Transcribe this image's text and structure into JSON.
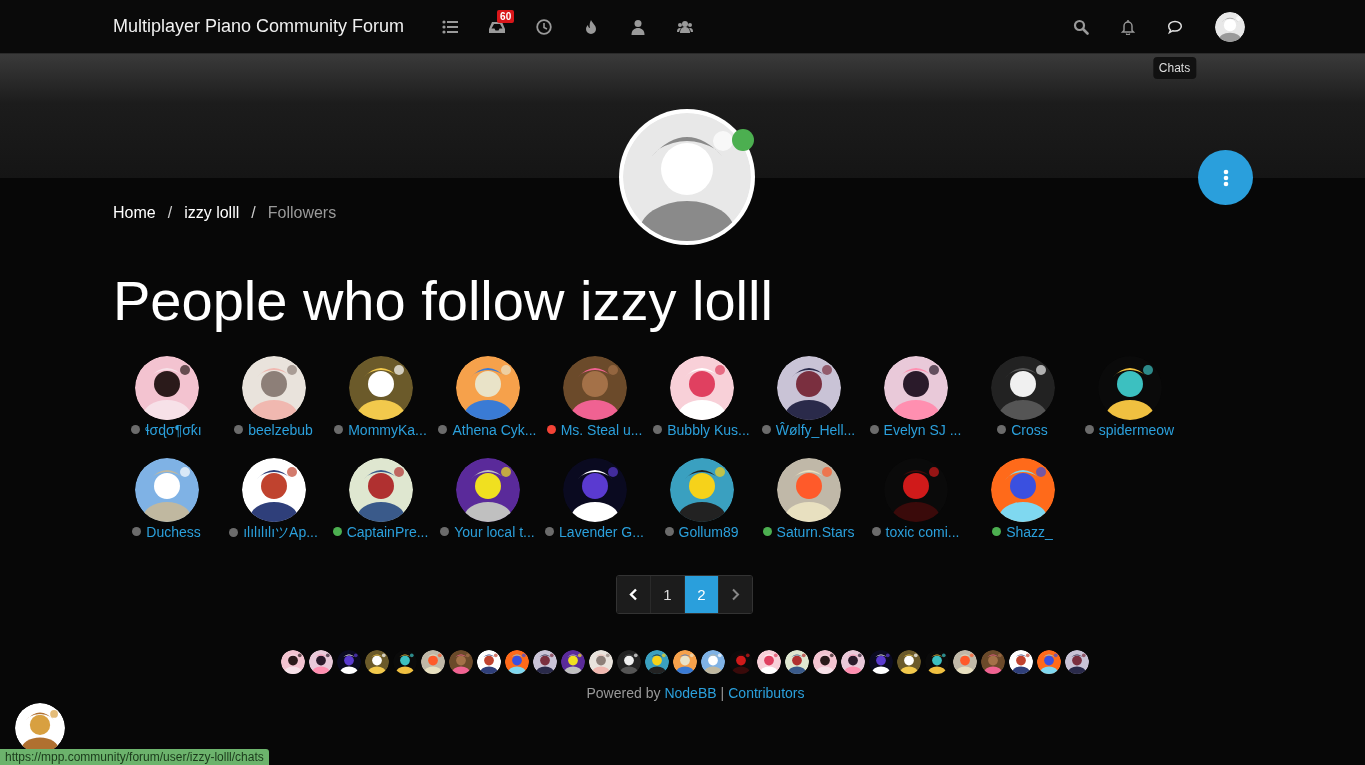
{
  "navbar": {
    "brand": "Multiplayer Piano Community Forum",
    "nav_items": [
      {
        "kind": "list"
      },
      {
        "kind": "inbox",
        "badge": "60"
      },
      {
        "kind": "clock"
      },
      {
        "kind": "fire"
      },
      {
        "kind": "user"
      },
      {
        "kind": "users"
      }
    ],
    "right_items": [
      {
        "kind": "search"
      },
      {
        "kind": "bell"
      },
      {
        "kind": "chat"
      }
    ],
    "tooltip": "Chats"
  },
  "profile": {
    "online": true
  },
  "breadcrumb": [
    {
      "label": "Home",
      "current": false
    },
    {
      "separator": "/",
      "label": "izzy lolll",
      "current": false
    },
    {
      "separator": "/",
      "label": "Followers",
      "current": true
    }
  ],
  "heading": "People who follow izzy lolll",
  "followers": [
    {
      "name": "ɬσɖσ¶σƙı",
      "color": "#6b6b6b"
    },
    {
      "name": "beelzebub",
      "color": "#6b6b6b"
    },
    {
      "name": "MommyKa...",
      "color": "#6b6b6b"
    },
    {
      "name": "Athena Cyk...",
      "color": "#6b6b6b"
    },
    {
      "name": "Ms. Steal u...",
      "color": "#f44336"
    },
    {
      "name": "Bubbly Kus...",
      "color": "#6b6b6b"
    },
    {
      "name": "Ŵølfy_Hell...",
      "color": "#6b6b6b"
    },
    {
      "name": "Evelyn SJ ...",
      "color": "#6b6b6b"
    },
    {
      "name": "Cross",
      "color": "#6b6b6b"
    },
    {
      "name": "spidermeow",
      "color": "#6b6b6b"
    },
    {
      "name": "Duchess",
      "color": "#6b6b6b"
    },
    {
      "name": "ılılılılıツAp...",
      "color": "#6b6b6b"
    },
    {
      "name": "CaptainPre...",
      "color": "#4caf50"
    },
    {
      "name": "Your local t...",
      "color": "#6b6b6b"
    },
    {
      "name": "Lavender G...",
      "color": "#6b6b6b"
    },
    {
      "name": "Gollum89",
      "color": "#6b6b6b"
    },
    {
      "name": "Saturn.Stars",
      "color": "#4caf50"
    },
    {
      "name": "toxic comi...",
      "color": "#6b6b6b"
    },
    {
      "name": "Shazz_",
      "color": "#4caf50"
    }
  ],
  "pagination": {
    "pages": [
      {
        "label": "1",
        "selected": false
      },
      {
        "label": "2",
        "selected": true
      }
    ]
  },
  "footer": {
    "powered_prefix": "Powered by",
    "powered_link": "NodeBB",
    "separator": "|",
    "contributors_link": "Contributors"
  },
  "status_url": "https://mpp.community/forum/user/izzy-lolll/chats"
}
